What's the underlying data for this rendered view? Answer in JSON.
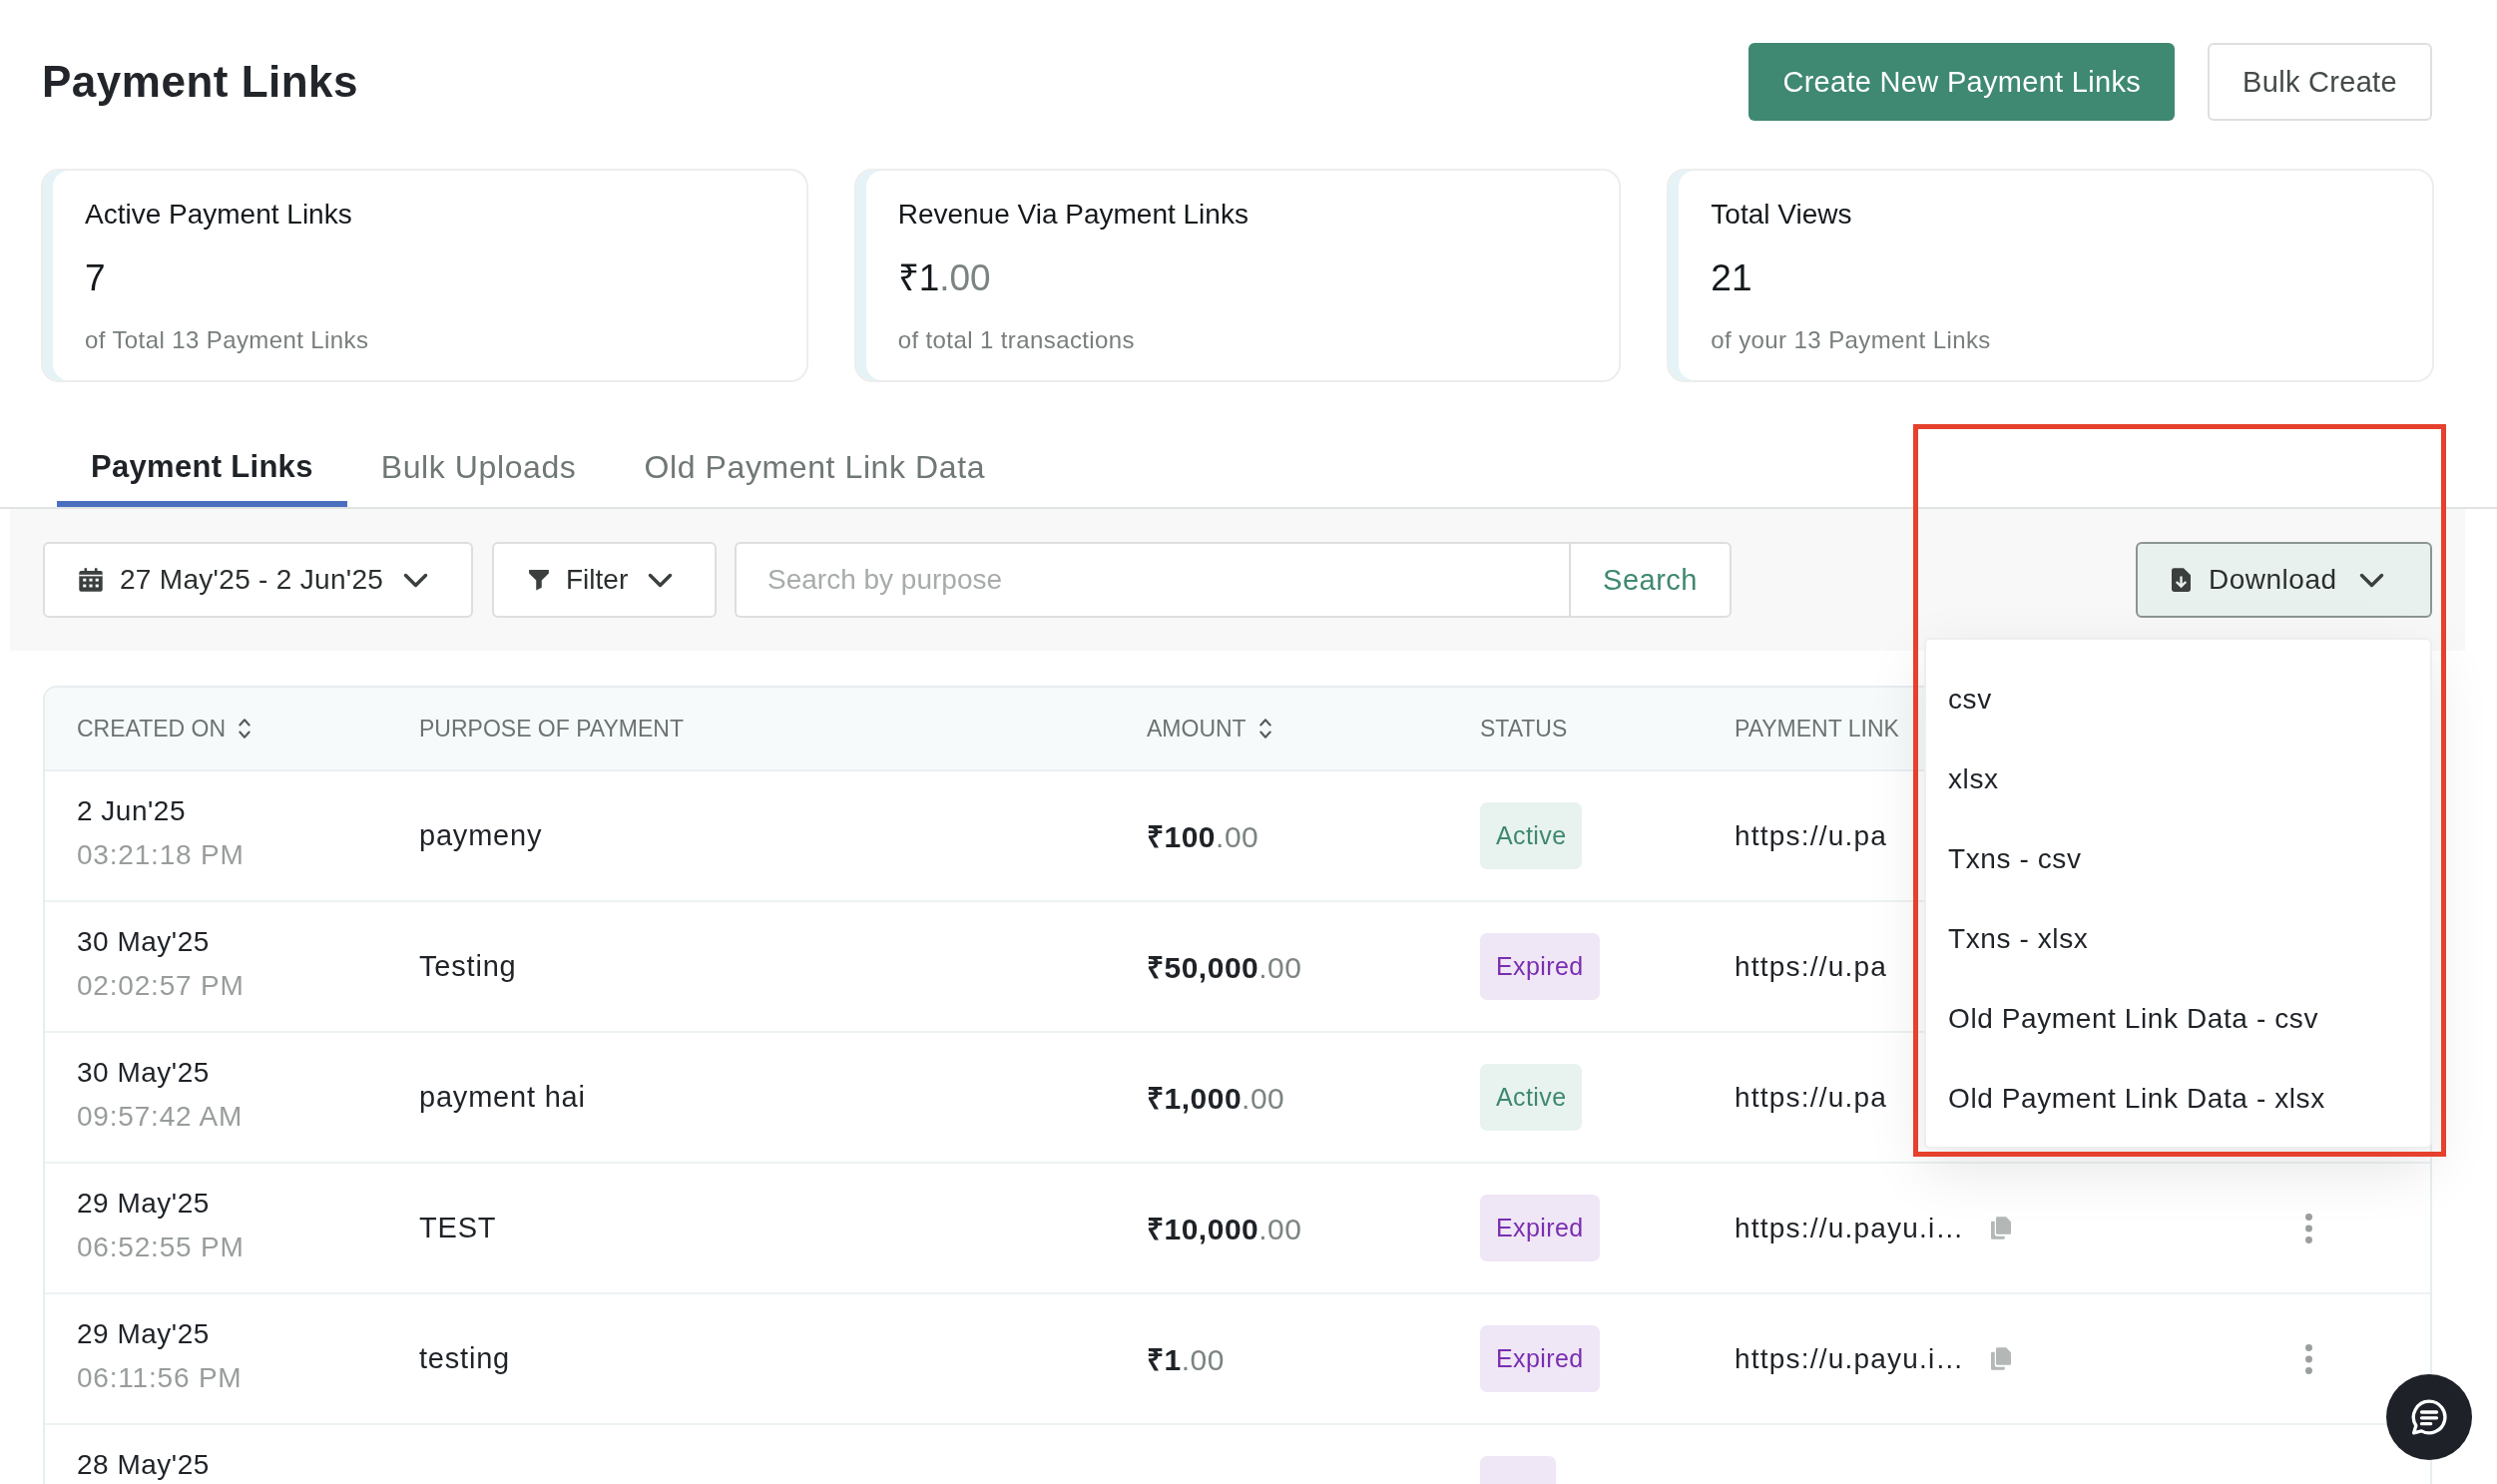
{
  "page": {
    "title": "Payment Links"
  },
  "header_buttons": [
    {
      "label": "Create New Payment Links",
      "kind": "primary"
    },
    {
      "label": "Bulk Create",
      "kind": "secondary"
    }
  ],
  "stats": [
    {
      "title": "Active Payment Links",
      "value": "7",
      "caption": "of Total 13 Payment Links"
    },
    {
      "title": "Revenue Via Payment Links",
      "value": "₹1.00",
      "caption": "of total 1 transactions"
    },
    {
      "title": "Total Views",
      "value": "21",
      "caption": "of your 13 Payment Links"
    }
  ],
  "tabs": [
    {
      "label": "Payment Links",
      "selected": true
    },
    {
      "label": "Bulk Uploads",
      "selected": false
    },
    {
      "label": "Old Payment Link Data",
      "selected": false
    }
  ],
  "toolbar": {
    "date_range": "27 May'25 - 2 Jun'25",
    "filter": "Filter",
    "search": {
      "placeholder": "Search by purpose",
      "button": "Search"
    },
    "download": {
      "label": "Download",
      "expanded": true,
      "highlighted": true,
      "options": [
        "csv",
        "xlsx",
        "Txns - csv",
        "Txns - xlsx",
        "Old Payment Link Data - csv",
        "Old Payment Link Data - xlsx"
      ]
    }
  },
  "table": {
    "columns": [
      {
        "label": "CREATED ON",
        "sortable": true
      },
      {
        "label": "PURPOSE OF PAYMENT",
        "sortable": false
      },
      {
        "label": "AMOUNT",
        "sortable": true
      },
      {
        "label": "STATUS",
        "sortable": false
      },
      {
        "label": "PAYMENT LINK",
        "sortable": false
      }
    ],
    "rows": [
      {
        "kind": "covered",
        "date": "2 Jun'25",
        "time": "03:21:18 PM",
        "purpose": "paymeny",
        "amount": "₹100.00",
        "status": {
          "label": "Active",
          "kind": "active"
        },
        "link": "https://u.pa"
      },
      {
        "kind": "covered",
        "date": "30 May'25",
        "time": "02:02:57 PM",
        "purpose": "Testing",
        "amount": "₹50,000.00",
        "status": {
          "label": "Expired",
          "kind": "expired"
        },
        "link": "https://u.pa"
      },
      {
        "kind": "covered",
        "date": "30 May'25",
        "time": "09:57:42 AM",
        "purpose": "payment hai",
        "amount": "₹1,000.00",
        "status": {
          "label": "Active",
          "kind": "active"
        },
        "link": "https://u.pa"
      },
      {
        "kind": "full",
        "date": "29 May'25",
        "time": "06:52:55 PM",
        "purpose": "TEST",
        "amount": "₹10,000.00",
        "status": {
          "label": "Expired",
          "kind": "expired"
        },
        "link": "https://u.payu.i…"
      },
      {
        "kind": "full",
        "date": "29 May'25",
        "time": "06:11:56 PM",
        "purpose": "testing",
        "amount": "₹1.00",
        "status": {
          "label": "Expired",
          "kind": "expired"
        },
        "link": "https://u.payu.i…"
      },
      {
        "kind": "cut",
        "date": "28 May'25",
        "status": {
          "kind": "expired"
        }
      }
    ]
  }
}
